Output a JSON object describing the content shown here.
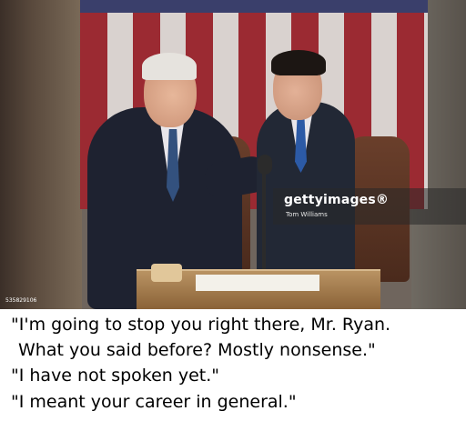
{
  "photo": {
    "watermark": {
      "brand": "gettyimages®",
      "credit": "Tom Williams"
    },
    "image_id": "535829106"
  },
  "caption": {
    "lines": [
      "\"I'm going to stop you right there, Mr. Ryan.",
      "What you said before? Mostly nonsense.\"",
      "\"I have not spoken yet.\"",
      "\"I meant your career in general.\""
    ]
  }
}
